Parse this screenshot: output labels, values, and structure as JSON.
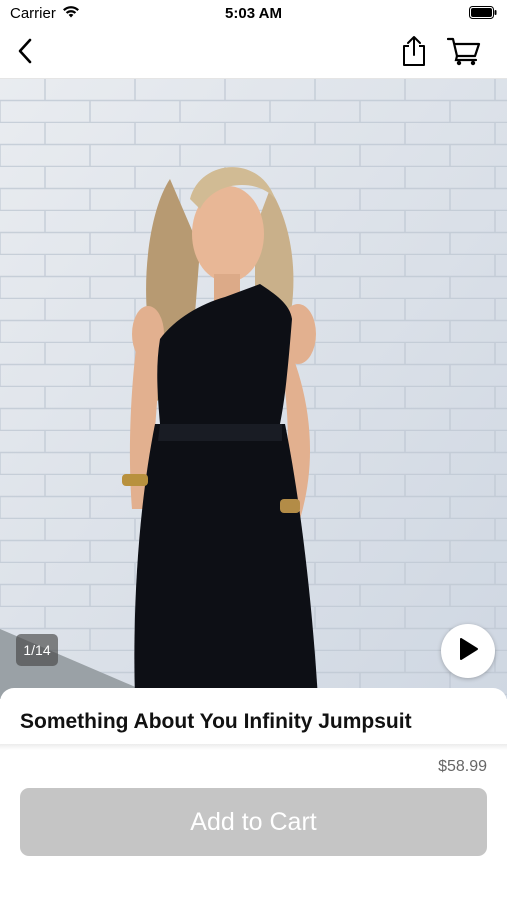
{
  "status_bar": {
    "carrier": "Carrier",
    "time": "5:03 AM"
  },
  "nav": {
    "back_icon": "chevron-left-icon",
    "share_icon": "share-icon",
    "cart_icon": "cart-icon"
  },
  "gallery": {
    "counter": "1/14",
    "play_icon": "play-icon"
  },
  "product": {
    "title": "Something About You Infinity Jumpsuit",
    "price": "$58.99",
    "add_to_cart_label": "Add to Cart"
  },
  "colors": {
    "button_disabled": "#c5c5c5",
    "wall": "#dfe4ea",
    "jumpsuit": "#0d0f15"
  }
}
